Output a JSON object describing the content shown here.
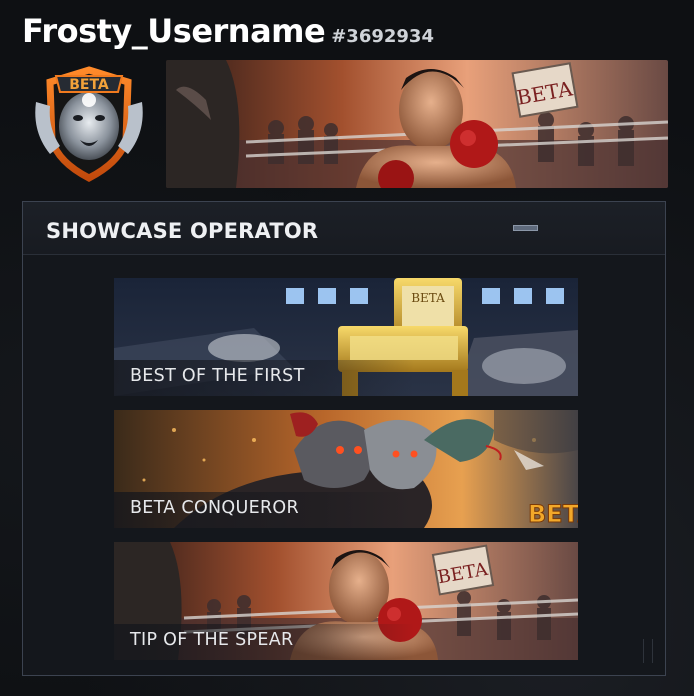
{
  "profile": {
    "username": "Frosty_Username",
    "user_tag": "#3692934",
    "emblem_text": "BETA",
    "banner_sign_text": "BETA"
  },
  "showcase": {
    "title": "SHOWCASE OPERATOR",
    "minimize_icon": "minimize-icon",
    "cards": [
      {
        "label": "BEST OF THE FIRST",
        "badge": "BETA"
      },
      {
        "label": "BETA CONQUEROR",
        "badge": "BETA"
      },
      {
        "label": "TIP OF THE SPEAR",
        "badge": "BETA"
      }
    ]
  },
  "colors": {
    "background": "#0e1013",
    "panel": "#14171c",
    "panel_border": "#3c4350",
    "accent_orange": "#f07a1e",
    "gold": "#e6b93a"
  }
}
